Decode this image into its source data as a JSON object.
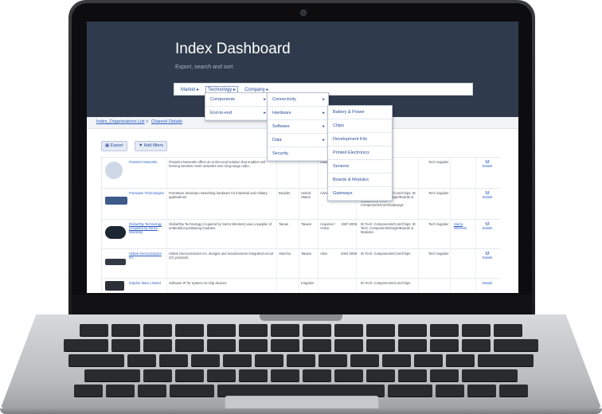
{
  "dashboard": {
    "title": "Index Dashboard",
    "subtitle": "Export, search and sort"
  },
  "menubar": {
    "items": [
      "Market ▸",
      "Technology ▸",
      "Company ▸"
    ]
  },
  "menus": {
    "level1": [
      "Components",
      "End-to-end"
    ],
    "level2": [
      "Connectivity",
      "Hardware",
      "Software",
      "Data",
      "Security"
    ],
    "level3": [
      "Battery & Power",
      "Chips",
      "Development Kits",
      "Printed Electronics",
      "Sensors",
      "Boards & Modules",
      "Gateways"
    ]
  },
  "breadcrumb": [
    "Index_Organizations List",
    "Channel Details"
  ],
  "toolbar": {
    "export": "Export",
    "filters": "Add filters"
  },
  "rows": [
    {
      "name": "Flowmint Networks",
      "desc": "Flowmint Networks offers an end-to-end solution that enables self-forming wireless mesh networks over long-range radio.",
      "country": "",
      "city": "",
      "status": "Alive",
      "year": "",
      "segment": "",
      "type": "Tech Supplier",
      "extra": "",
      "action": "Details"
    },
    {
      "name": "Freewave Technologies",
      "desc": "FreeWave develops networking hardware for industrial and military applications.",
      "country": "Boulder",
      "city": "United States",
      "status": "Alive",
      "year": "1993",
      "segment": "ID Tech: Components/Core/Chips; ID Tech: Components/Single/Boards & Modules; ID Tech: Components/Core/Gateways",
      "type": "Tech Supplier",
      "extra": "",
      "action": "Details"
    },
    {
      "name": "GlobalTop Technology (Acquired by Sierra Wireless)",
      "desc": "GlobalTop Technology (Acquired by Sierra Wireless) was a supplier of embedded positioning modules.",
      "country": "Tainan",
      "city": "Taiwan",
      "status": "Acquired / Active",
      "year": "1997-2005",
      "segment": "ID Tech: Components/Core/Chips; ID Tech: Components/Single/Boards & Modules",
      "type": "Tech Supplier",
      "extra": "Sierra Wireless",
      "action": "Details"
    },
    {
      "name": "Holtek Semiconductor Inc.",
      "desc": "Holtek Semiconductor Inc. designs and manufactures integrated circuit (IC) products.",
      "country": "Hsinchu",
      "city": "Taiwan",
      "status": "Alive",
      "year": "2004-2005",
      "segment": "ID Tech: Components/Core/Chips",
      "type": "Tech Supplier",
      "extra": "",
      "action": "Details"
    },
    {
      "name": "Dolphin Ware Limited",
      "desc": "Software IP for system-on-chip devices",
      "country": "",
      "city": "Kingdom",
      "status": "",
      "year": "",
      "segment": "ID Tech: Components/Core/Chips",
      "type": "",
      "extra": "",
      "action": "Details"
    }
  ]
}
